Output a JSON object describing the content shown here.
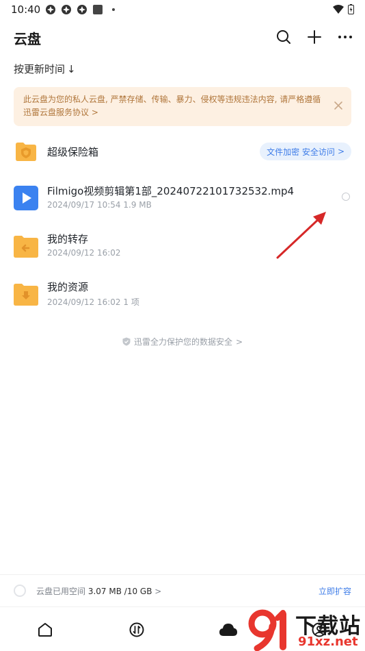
{
  "status_bar": {
    "time": "10:40"
  },
  "header": {
    "title": "云盘"
  },
  "sort": {
    "label": "按更新时间",
    "arrow": "↓"
  },
  "notice": {
    "text": "此云盘为您的私人云盘, 严禁存储、传输、暴力、侵权等违规违法内容, 请严格遵循",
    "link": "迅雷云盘服务协议",
    "chevron": ">"
  },
  "vault": {
    "name": "超级保险箱",
    "pill": "文件加密 安全访问",
    "pill_chevron": ">"
  },
  "files": [
    {
      "name": "Filmigo视频剪辑第1部_20240722101732532.mp4",
      "meta": "2024/09/17 10:54  1.9 MB",
      "icon": "video-file-icon"
    },
    {
      "name": "我的转存",
      "meta": "2024/09/12 16:02",
      "icon": "folder-transfer-icon"
    },
    {
      "name": "我的资源",
      "meta": "2024/09/12 16:02  1 项",
      "icon": "folder-download-icon"
    }
  ],
  "footer_note": {
    "text": "迅雷全力保护您的数据安全",
    "chevron": ">"
  },
  "storage": {
    "label": "云盘已用空间",
    "value": "3.07 MB /10 GB",
    "chevron": ">",
    "action": "立即扩容"
  },
  "watermark": {
    "brand": "下载站",
    "url": "91xz.net"
  },
  "colors": {
    "accent": "#3f7de8",
    "notice_bg": "#fdf0e2",
    "notice_text": "#b0763b",
    "folder": "#f8b545",
    "annotation_arrow": "#d62828"
  }
}
